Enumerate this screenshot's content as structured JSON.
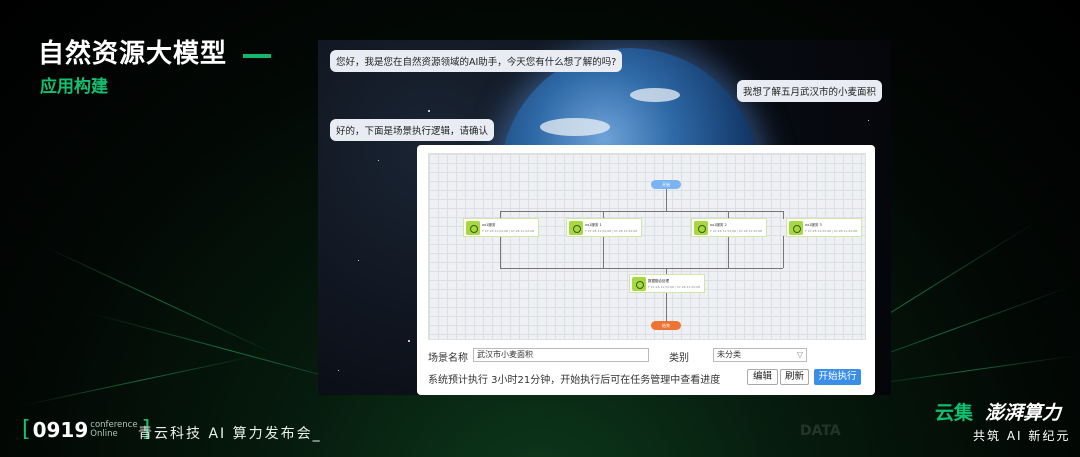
{
  "header": {
    "title": "自然资源大模型",
    "subtitle": "应用构建"
  },
  "chat": {
    "assistant_greeting": "您好，我是您在自然资源领域的AI助手，今天您有什么想了解的吗?",
    "user_message": "我想了解五月武汉市的小麦面积",
    "assistant_reply": "好的，下面是场景执行逻辑，请确认"
  },
  "workflow": {
    "start_label": "开始",
    "end_label": "结束",
    "nodes": [
      {
        "name": "xx1服务",
        "time": "T 07-28 11:52:08 | 07-28 11:52:08"
      },
      {
        "name": "xx1服务 1",
        "time": "T 07-28 11:52:08 | 07-28 11:52:08"
      },
      {
        "name": "xx1服务 2",
        "time": "T 07-28 11:52:08 | 07-28 11:52:08"
      },
      {
        "name": "xx1服务 3",
        "time": "T 07-28 11:52:08 | 07-28 11:52:08"
      },
      {
        "name": "数据融合处理",
        "time": "T 07-28 11:52:08 | 07-28 11:52:08"
      }
    ]
  },
  "form": {
    "scene_name_label": "场景名称",
    "scene_name_value": "武汉市小麦面积",
    "category_label": "类别",
    "category_value": "未分类",
    "estimate_text": "系统预计执行 3小时21分钟，开始执行后可在任务管理中查看进度",
    "edit_label": "编辑",
    "refresh_label": "刷新",
    "start_label": "开始执行"
  },
  "footer": {
    "event_code": "0919",
    "conf_line1": "conference",
    "conf_line2": "Online",
    "slogan": "青云科技 AI 算力发布会_",
    "watermark": "DATA",
    "brand_part1": "云集",
    "brand_part2": "澎湃算力",
    "tagline": "共筑 AI 新纪元"
  },
  "colors": {
    "accent_green": "#13b76b",
    "primary_blue": "#3b8ee8",
    "node_start": "#7bb4f2",
    "node_end": "#ee7433"
  }
}
